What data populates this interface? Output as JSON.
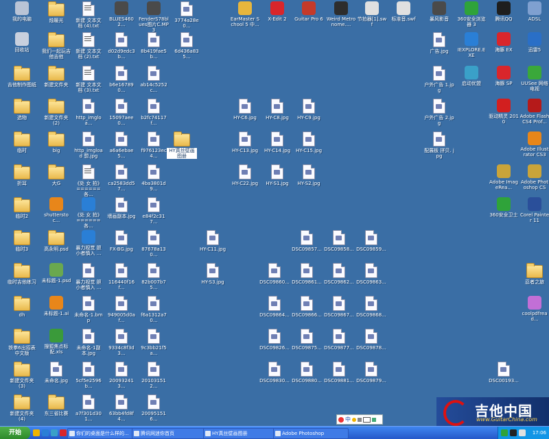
{
  "desktop_icons": [
    {
      "label": "我的电脑",
      "icon": "my-computer-icon",
      "kind": "app",
      "color": "#b9c4d6"
    },
    {
      "label": "烛暖光",
      "icon": "folder-icon",
      "kind": "folder"
    },
    {
      "label": "新建 文本文档 (4).txt",
      "icon": "text-file-icon",
      "kind": "doc"
    },
    {
      "label": "BLUES4602...",
      "icon": "media-file-icon",
      "kind": "app",
      "color": "#4a4a4a"
    },
    {
      "label": "FenderS78blues图片C.MP3",
      "icon": "audio-file-icon",
      "kind": "app",
      "color": "#4a4a4a"
    },
    {
      "label": "3774a28e0...",
      "icon": "image-file-icon",
      "kind": "file"
    },
    {
      "label": "EarMaster School 5 中...",
      "icon": "earmaster-icon",
      "kind": "app",
      "color": "#e8b63c"
    },
    {
      "label": "X-Edit 2",
      "icon": "x-edit-icon",
      "kind": "app",
      "color": "#d9262b"
    },
    {
      "label": "Guitar Pro 6",
      "icon": "guitar-pro-icon",
      "kind": "app",
      "color": "#c43a2a"
    },
    {
      "label": "Weird Metronome....",
      "icon": "metronome-icon",
      "kind": "app",
      "color": "#2d2d2d"
    },
    {
      "label": "节拍器[1].swf",
      "icon": "swf-file-icon",
      "kind": "app",
      "color": "#e0e0e0"
    },
    {
      "label": "标准音.swf",
      "icon": "swf-file-icon",
      "kind": "app",
      "color": "#e0e0e0"
    },
    {
      "label": "暴风影音",
      "icon": "storm-player-icon",
      "kind": "app",
      "color": "#4a4a4a"
    },
    {
      "label": "360安全浏览器 3",
      "icon": "360-browser-icon",
      "kind": "app",
      "color": "#2fa33a"
    },
    {
      "label": "腾讯QQ",
      "icon": "qq-icon",
      "kind": "app",
      "color": "#1e1e1e"
    },
    {
      "label": "ADSL",
      "icon": "network-icon",
      "kind": "app",
      "color": "#7fa0d0"
    },
    {
      "label": "回收站",
      "icon": "recycle-bin-icon",
      "kind": "app",
      "color": "#c8d0de"
    },
    {
      "label": "我们一起玩吉他吉他",
      "icon": "folder-icon",
      "kind": "folder"
    },
    {
      "label": "新建 文本文档 (2).txt",
      "icon": "text-file-icon",
      "kind": "doc"
    },
    {
      "label": "d02d9edc3b...",
      "icon": "image-file-icon",
      "kind": "file"
    },
    {
      "label": "8b419fae5b...",
      "icon": "image-file-icon",
      "kind": "file"
    },
    {
      "label": "6d436a835...",
      "icon": "image-file-icon",
      "kind": "file"
    },
    {
      "label": "广告.jpg",
      "icon": "image-file-icon",
      "kind": "file"
    },
    {
      "label": "IEXPLORE.EXE",
      "icon": "ie-icon",
      "kind": "app",
      "color": "#2a7fd6"
    },
    {
      "label": "海豚 EX",
      "icon": "mushroom-icon",
      "kind": "app",
      "color": "#d9262b"
    },
    {
      "label": "迅雷5",
      "icon": "thunder-icon",
      "kind": "app",
      "color": "#2a6fc7"
    },
    {
      "label": "吉他制作图纸",
      "icon": "folder-icon",
      "kind": "folder"
    },
    {
      "label": "新建文件夹",
      "icon": "folder-icon",
      "kind": "folder"
    },
    {
      "label": "新建 文本文档 (3).txt",
      "icon": "text-file-icon",
      "kind": "doc"
    },
    {
      "label": "b6e167890...",
      "icon": "image-file-icon",
      "kind": "file"
    },
    {
      "label": "ab14c5252c...",
      "icon": "image-file-icon",
      "kind": "file"
    },
    {
      "label": "户外广告 1.jpg",
      "icon": "image-file-icon",
      "kind": "file"
    },
    {
      "label": "启动优盟",
      "icon": "launcher-icon",
      "kind": "app",
      "color": "#3aa0c8"
    },
    {
      "label": "海豚 SP",
      "icon": "mario-icon",
      "kind": "app",
      "color": "#d9262b"
    },
    {
      "label": "UUSee 网络电视",
      "icon": "uusee-icon",
      "kind": "app",
      "color": "#3aa83a"
    },
    {
      "label": "选物",
      "icon": "folder-icon",
      "kind": "folder"
    },
    {
      "label": "新建文件夹 (2)",
      "icon": "folder-icon",
      "kind": "folder"
    },
    {
      "label": "http_imgloa...",
      "icon": "image-file-icon",
      "kind": "file"
    },
    {
      "label": "15097aee0...",
      "icon": "image-file-icon",
      "kind": "file"
    },
    {
      "label": "b2fc74117f...",
      "icon": "image-file-icon",
      "kind": "file"
    },
    {
      "label": "HY-C6.jpg",
      "icon": "image-file-icon",
      "kind": "file"
    },
    {
      "label": "HY-C8.jpg",
      "icon": "image-file-icon",
      "kind": "file"
    },
    {
      "label": "HY-C9.jpg",
      "icon": "image-file-icon",
      "kind": "file"
    },
    {
      "label": "户外广告 2.jpg",
      "icon": "image-file-icon",
      "kind": "file"
    },
    {
      "label": "驱动精灵 2010",
      "icon": "driver-genius-icon",
      "kind": "app",
      "color": "#d21f1f"
    },
    {
      "label": "Adobe Flash CS4 Prof...",
      "icon": "flash-icon",
      "kind": "app",
      "color": "#b51a1a"
    },
    {
      "label": "临时",
      "icon": "folder-icon",
      "kind": "folder"
    },
    {
      "label": "big",
      "icon": "folder-icon",
      "kind": "folder"
    },
    {
      "label": "http_imgload 想.jpg",
      "icon": "image-file-icon",
      "kind": "file"
    },
    {
      "label": "a6a6ebae5...",
      "icon": "image-file-icon",
      "kind": "file"
    },
    {
      "label": "f976123ec4...",
      "icon": "image-file-icon",
      "kind": "file"
    },
    {
      "label": "HY真丝壁画图册",
      "icon": "folder-icon",
      "kind": "folder",
      "selected": true
    },
    {
      "label": "HY-C13.jpg",
      "icon": "image-file-icon",
      "kind": "file"
    },
    {
      "label": "HY-C14.jpg",
      "icon": "image-file-icon",
      "kind": "file"
    },
    {
      "label": "HY-C15.jpg",
      "icon": "image-file-icon",
      "kind": "file"
    },
    {
      "label": "配展板 拼贝. jpg",
      "icon": "image-file-icon",
      "kind": "file"
    },
    {
      "label": "Adobe Illustrator CS3",
      "icon": "illustrator-icon",
      "kind": "app",
      "color": "#e8861a"
    },
    {
      "label": "折耳",
      "icon": "folder-icon",
      "kind": "folder"
    },
    {
      "label": "大G",
      "icon": "folder-icon",
      "kind": "folder"
    },
    {
      "label": "《处 女 拍》======各...",
      "icon": "text-file-icon",
      "kind": "doc"
    },
    {
      "label": "ca2583dd57...",
      "icon": "image-file-icon",
      "kind": "file"
    },
    {
      "label": "4ba3801d9...",
      "icon": "image-file-icon",
      "kind": "file"
    },
    {
      "label": "HY-C22.jpg",
      "icon": "image-file-icon",
      "kind": "file"
    },
    {
      "label": "HY-S1.jpg",
      "icon": "image-file-icon",
      "kind": "file"
    },
    {
      "label": "HY-S2.jpg",
      "icon": "image-file-icon",
      "kind": "file"
    },
    {
      "label": "Adobe ImageRea...",
      "icon": "imageready-icon",
      "kind": "app",
      "color": "#c9a43a"
    },
    {
      "label": "Adobe Photoshop CS",
      "icon": "photoshop-icon",
      "kind": "app",
      "color": "#c9a43a"
    },
    {
      "label": "临时2",
      "icon": "folder-icon",
      "kind": "folder"
    },
    {
      "label": "shutterstoc...",
      "icon": "ai-file-icon",
      "kind": "app",
      "color": "#e8861a"
    },
    {
      "label": "《处 女 拍》======各...",
      "icon": "ie-file-icon",
      "kind": "app",
      "color": "#2a7fd6"
    },
    {
      "label": "墙画副本.jpg",
      "icon": "image-file-icon",
      "kind": "file"
    },
    {
      "label": "e84f2c317...",
      "icon": "image-file-icon",
      "kind": "file"
    },
    {
      "label": "360安全卫士",
      "icon": "360-safe-icon",
      "kind": "app",
      "color": "#2fa33a"
    },
    {
      "label": "Corel Painter 11",
      "icon": "painter-icon",
      "kind": "app",
      "color": "#2a4f9a"
    },
    {
      "label": "临时3",
      "icon": "folder-icon",
      "kind": "folder"
    },
    {
      "label": "高永明.psd",
      "icon": "folder-icon",
      "kind": "folder"
    },
    {
      "label": "暴力视觉 胆小者慎入 ...",
      "icon": "ie-file-icon",
      "kind": "app",
      "color": "#2a7fd6"
    },
    {
      "label": "FX-BG.jpg",
      "icon": "image-file-icon",
      "kind": "file"
    },
    {
      "label": "87678a130...",
      "icon": "image-file-icon",
      "kind": "file"
    },
    {
      "label": "HY-C11.jpg",
      "icon": "image-file-icon",
      "kind": "file"
    },
    {
      "label": "DSC09857...",
      "icon": "image-file-icon",
      "kind": "file"
    },
    {
      "label": "DSC09858...",
      "icon": "image-file-icon",
      "kind": "file"
    },
    {
      "label": "DSC09859...",
      "icon": "image-file-icon",
      "kind": "file"
    },
    {
      "label": "临时吉他练习",
      "icon": "folder-icon",
      "kind": "folder"
    },
    {
      "label": "未标题-1.psd",
      "icon": "psd-file-icon",
      "kind": "app",
      "color": "#6aa84f"
    },
    {
      "label": "暴力视觉 胆小者慎入 ...",
      "icon": "image-file-icon",
      "kind": "file"
    },
    {
      "label": "116440f16f...",
      "icon": "image-file-icon",
      "kind": "file"
    },
    {
      "label": "82b007b75...",
      "icon": "image-file-icon",
      "kind": "file"
    },
    {
      "label": "HY-S3.jpg",
      "icon": "image-file-icon",
      "kind": "file"
    },
    {
      "label": "DSC09860...",
      "icon": "image-file-icon",
      "kind": "file"
    },
    {
      "label": "DSC09861...",
      "icon": "image-file-icon",
      "kind": "file"
    },
    {
      "label": "DSC09862...",
      "icon": "image-file-icon",
      "kind": "file"
    },
    {
      "label": "DSC09863...",
      "icon": "image-file-icon",
      "kind": "file"
    },
    {
      "label": "忍者之旅",
      "icon": "folder-icon",
      "kind": "folder"
    },
    {
      "label": "dh",
      "icon": "folder-icon",
      "kind": "folder"
    },
    {
      "label": "未标题-1.ai",
      "icon": "ai-file-icon",
      "kind": "app",
      "color": "#e8861a"
    },
    {
      "label": "未命名-1.bmp",
      "icon": "image-file-icon",
      "kind": "file"
    },
    {
      "label": "949005d0af...",
      "icon": "image-file-icon",
      "kind": "file"
    },
    {
      "label": "f6a1312a70...",
      "icon": "image-file-icon",
      "kind": "file"
    },
    {
      "label": "DSC09864...",
      "icon": "image-file-icon",
      "kind": "file"
    },
    {
      "label": "DSC09866...",
      "icon": "image-file-icon",
      "kind": "file"
    },
    {
      "label": "DSC09867...",
      "icon": "image-file-icon",
      "kind": "file"
    },
    {
      "label": "DSC09868...",
      "icon": "image-file-icon",
      "kind": "file"
    },
    {
      "label": "coolpdfread...",
      "icon": "pdf-file-icon",
      "kind": "app",
      "color": "#c26fd6"
    },
    {
      "label": "铁拳6出招表中文版",
      "icon": "folder-icon",
      "kind": "folder"
    },
    {
      "label": "搜狐焦点标配.xls",
      "icon": "xls-file-icon",
      "kind": "app",
      "color": "#3a9a3a"
    },
    {
      "label": "未命名-1副本.jpg",
      "icon": "image-file-icon",
      "kind": "file"
    },
    {
      "label": "9334c8f3d3...",
      "icon": "image-file-icon",
      "kind": "file"
    },
    {
      "label": "9c3bb21f5a...",
      "icon": "image-file-icon",
      "kind": "file"
    },
    {
      "label": "DSC09826...",
      "icon": "image-file-icon",
      "kind": "file"
    },
    {
      "label": "DSC09875...",
      "icon": "image-file-icon",
      "kind": "file"
    },
    {
      "label": "DSC09877...",
      "icon": "image-file-icon",
      "kind": "file"
    },
    {
      "label": "DSC09878...",
      "icon": "image-file-icon",
      "kind": "file"
    },
    {
      "label": "新建文件夹 (3)",
      "icon": "folder-icon",
      "kind": "folder"
    },
    {
      "label": "未命名.jpg",
      "icon": "image-file-icon",
      "kind": "file"
    },
    {
      "label": "5cf5e2596b...",
      "icon": "image-file-icon",
      "kind": "file"
    },
    {
      "label": "200932413...",
      "icon": "image-file-icon",
      "kind": "file"
    },
    {
      "label": "201031512...",
      "icon": "image-file-icon",
      "kind": "file"
    },
    {
      "label": "DSC09830...",
      "icon": "image-file-icon",
      "kind": "file"
    },
    {
      "label": "DSC09880...",
      "icon": "image-file-icon",
      "kind": "file"
    },
    {
      "label": "DSC09881...",
      "icon": "image-file-icon",
      "kind": "file"
    },
    {
      "label": "DSC09879...",
      "icon": "image-file-icon",
      "kind": "file"
    },
    {
      "label": "DSC00193...",
      "icon": "image-file-icon",
      "kind": "file"
    },
    {
      "label": "新建文件夹 (4)",
      "icon": "folder-icon",
      "kind": "folder"
    },
    {
      "label": "东三省比赛",
      "icon": "folder-icon",
      "kind": "folder"
    },
    {
      "label": "a7f301d301...",
      "icon": "image-file-icon",
      "kind": "file"
    },
    {
      "label": "63bb4fd8f4...",
      "icon": "image-file-icon",
      "kind": "file"
    },
    {
      "label": "200951516...",
      "icon": "image-file-icon",
      "kind": "file"
    }
  ],
  "ime_bar": {
    "mode_label": "中"
  },
  "taskbar": {
    "start_label": "开始",
    "tasks": [
      {
        "label": "你们的桌面是什么样的..."
      },
      {
        "label": "腾讯网迷你首页"
      },
      {
        "label": "HY真丝壁画图册"
      },
      {
        "label": "Adobe Photoshop"
      }
    ],
    "clock": "17:06"
  },
  "watermark": {
    "title": "吉他中国",
    "url": "www.GuitarChina.com"
  }
}
